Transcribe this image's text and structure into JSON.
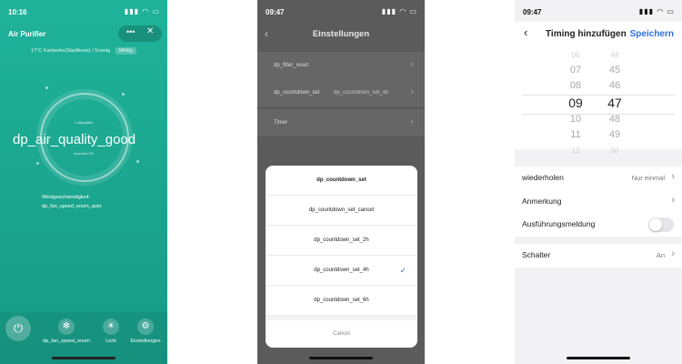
{
  "screen1": {
    "time": "10:16",
    "title": "Air Purifier",
    "menu_icon": "more-dots-icon",
    "close_icon": "close-icon",
    "subtitle": "17°C  Karlsruhe(Stadtkreis) / Sonnig",
    "badge": "MMdg",
    "ring_top": "Luftqualität",
    "air_quality": "dp_air_quality_good",
    "ring_bottom": "Innenluft OK",
    "speed_label": "Windgeschwindigkeit:",
    "speed_value": "dp_fan_speed_enum_auto",
    "tools": [
      {
        "label": "dp_fan_speed_enum",
        "icon": "fan-icon"
      },
      {
        "label": "Licht",
        "icon": "light-bulb-icon"
      },
      {
        "label": "Einstellungen",
        "icon": "settings-gear-icon"
      }
    ]
  },
  "screen2": {
    "time": "09:47",
    "title": "Einstellungen",
    "rows": [
      {
        "label": "dp_filter_reset",
        "value": ""
      },
      {
        "label": "dp_countdown_set",
        "value": "dp_countdown_set_4h"
      },
      {
        "label": "Timer",
        "value": ""
      }
    ],
    "sheet": {
      "header": "dp_countdown_set",
      "options": [
        {
          "label": "dp_countdown_set_cancel",
          "selected": false
        },
        {
          "label": "dp_countdown_set_2h",
          "selected": false
        },
        {
          "label": "dp_countdown_set_4h",
          "selected": true
        },
        {
          "label": "dp_countdown_set_6h",
          "selected": false
        }
      ],
      "cancel": "Cancel"
    }
  },
  "screen3": {
    "time": "09:47",
    "title": "Timing hinzufügen",
    "save": "Speichern",
    "picker": {
      "hours": [
        "06",
        "07",
        "08",
        "09",
        "10",
        "11",
        "12"
      ],
      "minutes": [
        "44",
        "45",
        "46",
        "47",
        "48",
        "49",
        "50"
      ],
      "selected_hour": "09",
      "selected_minute": "47"
    },
    "rows": [
      {
        "label": "wiederholen",
        "value": "Nur einmal"
      },
      {
        "label": "Anmerkung",
        "value": ""
      },
      {
        "label": "Ausführungsmeldung",
        "value": "",
        "toggle": false
      }
    ],
    "switch": {
      "label": "Schalter",
      "value": "An"
    }
  }
}
